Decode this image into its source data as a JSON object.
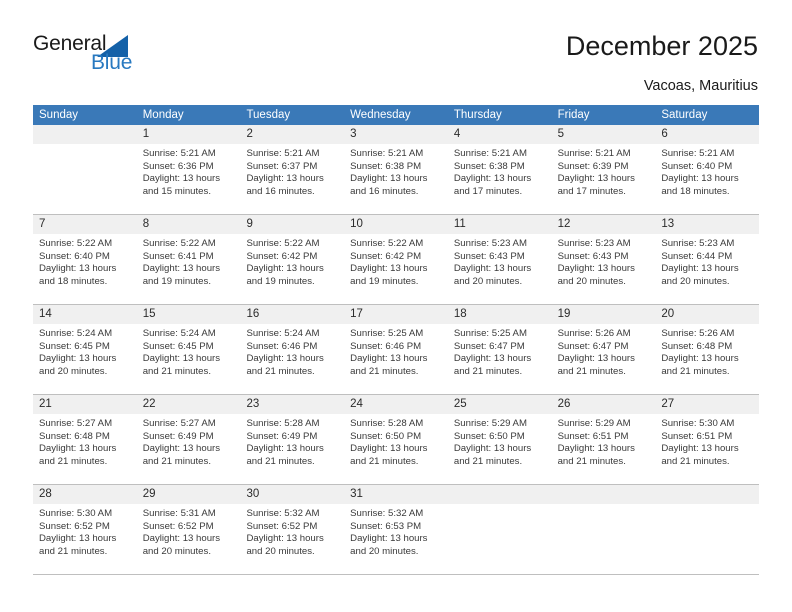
{
  "brand": {
    "name_part1": "General",
    "name_part2": "Blue",
    "logo_icon": "triangle-flag-icon",
    "accent_color": "#1461a8",
    "text_color": "#2879c0"
  },
  "header": {
    "title": "December 2025",
    "subtitle": "Vacoas, Mauritius"
  },
  "calendar": {
    "header_background": "#3a79b8",
    "header_text_color": "#ffffff",
    "weekday_headers": [
      "Sunday",
      "Monday",
      "Tuesday",
      "Wednesday",
      "Thursday",
      "Friday",
      "Saturday"
    ],
    "weeks": [
      [
        {
          "day": "",
          "sunrise": "",
          "sunset": "",
          "daylight_line1": "",
          "daylight_line2": ""
        },
        {
          "day": "1",
          "sunrise": "Sunrise: 5:21 AM",
          "sunset": "Sunset: 6:36 PM",
          "daylight_line1": "Daylight: 13 hours",
          "daylight_line2": "and 15 minutes."
        },
        {
          "day": "2",
          "sunrise": "Sunrise: 5:21 AM",
          "sunset": "Sunset: 6:37 PM",
          "daylight_line1": "Daylight: 13 hours",
          "daylight_line2": "and 16 minutes."
        },
        {
          "day": "3",
          "sunrise": "Sunrise: 5:21 AM",
          "sunset": "Sunset: 6:38 PM",
          "daylight_line1": "Daylight: 13 hours",
          "daylight_line2": "and 16 minutes."
        },
        {
          "day": "4",
          "sunrise": "Sunrise: 5:21 AM",
          "sunset": "Sunset: 6:38 PM",
          "daylight_line1": "Daylight: 13 hours",
          "daylight_line2": "and 17 minutes."
        },
        {
          "day": "5",
          "sunrise": "Sunrise: 5:21 AM",
          "sunset": "Sunset: 6:39 PM",
          "daylight_line1": "Daylight: 13 hours",
          "daylight_line2": "and 17 minutes."
        },
        {
          "day": "6",
          "sunrise": "Sunrise: 5:21 AM",
          "sunset": "Sunset: 6:40 PM",
          "daylight_line1": "Daylight: 13 hours",
          "daylight_line2": "and 18 minutes."
        }
      ],
      [
        {
          "day": "7",
          "sunrise": "Sunrise: 5:22 AM",
          "sunset": "Sunset: 6:40 PM",
          "daylight_line1": "Daylight: 13 hours",
          "daylight_line2": "and 18 minutes."
        },
        {
          "day": "8",
          "sunrise": "Sunrise: 5:22 AM",
          "sunset": "Sunset: 6:41 PM",
          "daylight_line1": "Daylight: 13 hours",
          "daylight_line2": "and 19 minutes."
        },
        {
          "day": "9",
          "sunrise": "Sunrise: 5:22 AM",
          "sunset": "Sunset: 6:42 PM",
          "daylight_line1": "Daylight: 13 hours",
          "daylight_line2": "and 19 minutes."
        },
        {
          "day": "10",
          "sunrise": "Sunrise: 5:22 AM",
          "sunset": "Sunset: 6:42 PM",
          "daylight_line1": "Daylight: 13 hours",
          "daylight_line2": "and 19 minutes."
        },
        {
          "day": "11",
          "sunrise": "Sunrise: 5:23 AM",
          "sunset": "Sunset: 6:43 PM",
          "daylight_line1": "Daylight: 13 hours",
          "daylight_line2": "and 20 minutes."
        },
        {
          "day": "12",
          "sunrise": "Sunrise: 5:23 AM",
          "sunset": "Sunset: 6:43 PM",
          "daylight_line1": "Daylight: 13 hours",
          "daylight_line2": "and 20 minutes."
        },
        {
          "day": "13",
          "sunrise": "Sunrise: 5:23 AM",
          "sunset": "Sunset: 6:44 PM",
          "daylight_line1": "Daylight: 13 hours",
          "daylight_line2": "and 20 minutes."
        }
      ],
      [
        {
          "day": "14",
          "sunrise": "Sunrise: 5:24 AM",
          "sunset": "Sunset: 6:45 PM",
          "daylight_line1": "Daylight: 13 hours",
          "daylight_line2": "and 20 minutes."
        },
        {
          "day": "15",
          "sunrise": "Sunrise: 5:24 AM",
          "sunset": "Sunset: 6:45 PM",
          "daylight_line1": "Daylight: 13 hours",
          "daylight_line2": "and 21 minutes."
        },
        {
          "day": "16",
          "sunrise": "Sunrise: 5:24 AM",
          "sunset": "Sunset: 6:46 PM",
          "daylight_line1": "Daylight: 13 hours",
          "daylight_line2": "and 21 minutes."
        },
        {
          "day": "17",
          "sunrise": "Sunrise: 5:25 AM",
          "sunset": "Sunset: 6:46 PM",
          "daylight_line1": "Daylight: 13 hours",
          "daylight_line2": "and 21 minutes."
        },
        {
          "day": "18",
          "sunrise": "Sunrise: 5:25 AM",
          "sunset": "Sunset: 6:47 PM",
          "daylight_line1": "Daylight: 13 hours",
          "daylight_line2": "and 21 minutes."
        },
        {
          "day": "19",
          "sunrise": "Sunrise: 5:26 AM",
          "sunset": "Sunset: 6:47 PM",
          "daylight_line1": "Daylight: 13 hours",
          "daylight_line2": "and 21 minutes."
        },
        {
          "day": "20",
          "sunrise": "Sunrise: 5:26 AM",
          "sunset": "Sunset: 6:48 PM",
          "daylight_line1": "Daylight: 13 hours",
          "daylight_line2": "and 21 minutes."
        }
      ],
      [
        {
          "day": "21",
          "sunrise": "Sunrise: 5:27 AM",
          "sunset": "Sunset: 6:48 PM",
          "daylight_line1": "Daylight: 13 hours",
          "daylight_line2": "and 21 minutes."
        },
        {
          "day": "22",
          "sunrise": "Sunrise: 5:27 AM",
          "sunset": "Sunset: 6:49 PM",
          "daylight_line1": "Daylight: 13 hours",
          "daylight_line2": "and 21 minutes."
        },
        {
          "day": "23",
          "sunrise": "Sunrise: 5:28 AM",
          "sunset": "Sunset: 6:49 PM",
          "daylight_line1": "Daylight: 13 hours",
          "daylight_line2": "and 21 minutes."
        },
        {
          "day": "24",
          "sunrise": "Sunrise: 5:28 AM",
          "sunset": "Sunset: 6:50 PM",
          "daylight_line1": "Daylight: 13 hours",
          "daylight_line2": "and 21 minutes."
        },
        {
          "day": "25",
          "sunrise": "Sunrise: 5:29 AM",
          "sunset": "Sunset: 6:50 PM",
          "daylight_line1": "Daylight: 13 hours",
          "daylight_line2": "and 21 minutes."
        },
        {
          "day": "26",
          "sunrise": "Sunrise: 5:29 AM",
          "sunset": "Sunset: 6:51 PM",
          "daylight_line1": "Daylight: 13 hours",
          "daylight_line2": "and 21 minutes."
        },
        {
          "day": "27",
          "sunrise": "Sunrise: 5:30 AM",
          "sunset": "Sunset: 6:51 PM",
          "daylight_line1": "Daylight: 13 hours",
          "daylight_line2": "and 21 minutes."
        }
      ],
      [
        {
          "day": "28",
          "sunrise": "Sunrise: 5:30 AM",
          "sunset": "Sunset: 6:52 PM",
          "daylight_line1": "Daylight: 13 hours",
          "daylight_line2": "and 21 minutes."
        },
        {
          "day": "29",
          "sunrise": "Sunrise: 5:31 AM",
          "sunset": "Sunset: 6:52 PM",
          "daylight_line1": "Daylight: 13 hours",
          "daylight_line2": "and 20 minutes."
        },
        {
          "day": "30",
          "sunrise": "Sunrise: 5:32 AM",
          "sunset": "Sunset: 6:52 PM",
          "daylight_line1": "Daylight: 13 hours",
          "daylight_line2": "and 20 minutes."
        },
        {
          "day": "31",
          "sunrise": "Sunrise: 5:32 AM",
          "sunset": "Sunset: 6:53 PM",
          "daylight_line1": "Daylight: 13 hours",
          "daylight_line2": "and 20 minutes."
        },
        {
          "day": "",
          "sunrise": "",
          "sunset": "",
          "daylight_line1": "",
          "daylight_line2": ""
        },
        {
          "day": "",
          "sunrise": "",
          "sunset": "",
          "daylight_line1": "",
          "daylight_line2": ""
        },
        {
          "day": "",
          "sunrise": "",
          "sunset": "",
          "daylight_line1": "",
          "daylight_line2": ""
        }
      ]
    ]
  }
}
